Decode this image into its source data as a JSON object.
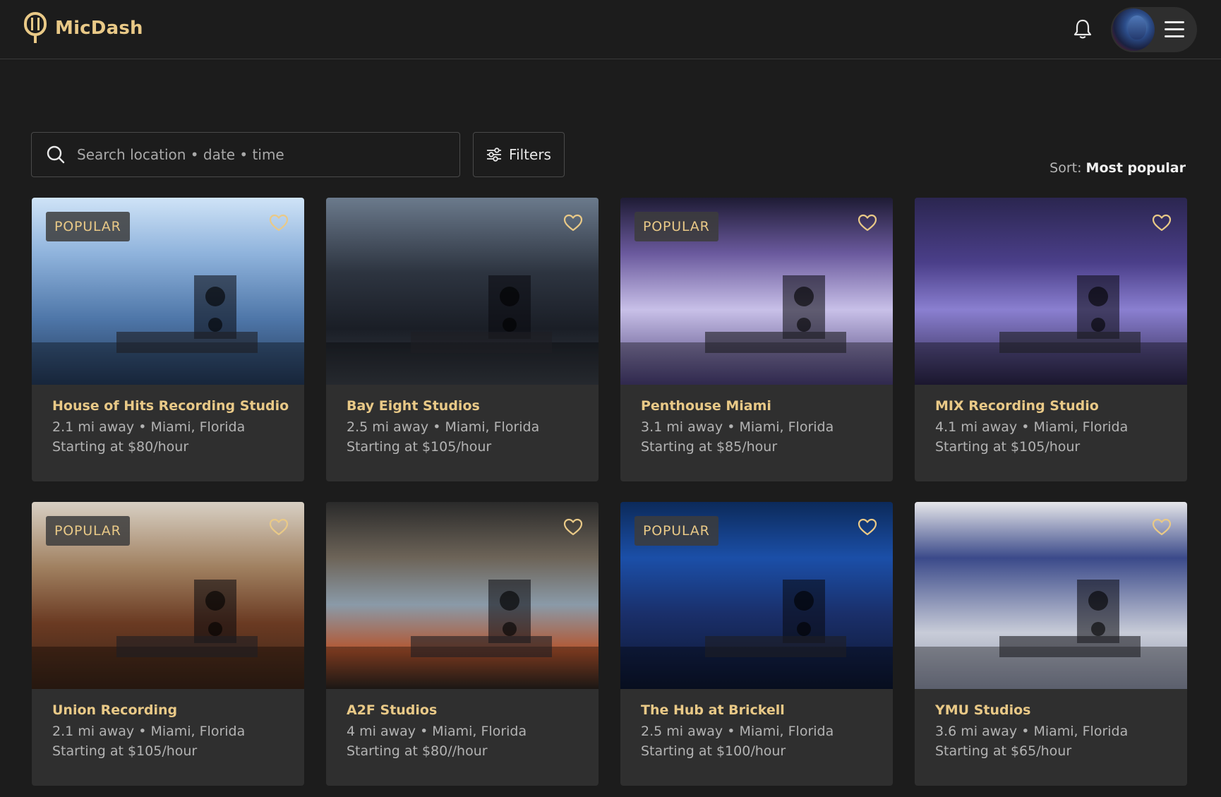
{
  "app": {
    "name": "MicDash"
  },
  "header": {
    "notifications_icon": "bell-icon",
    "menu_icon": "hamburger-icon"
  },
  "search": {
    "placeholder": "Search location • date • time",
    "filters_label": "Filters"
  },
  "sort": {
    "label": "Sort:",
    "value": "Most popular"
  },
  "studios": [
    {
      "name": "House of Hits Recording Studio",
      "distance": "2.1 mi away • Miami, Florida",
      "price": "Starting at $80/hour",
      "badge": "POPULAR"
    },
    {
      "name": "Bay Eight Studios",
      "distance": "2.5 mi away • Miami, Florida",
      "price": "Starting at $105/hour",
      "badge": ""
    },
    {
      "name": "Penthouse Miami",
      "distance": "3.1 mi away • Miami, Florida",
      "price": "Starting at $85/hour",
      "badge": "POPULAR"
    },
    {
      "name": "MIX Recording Studio",
      "distance": "4.1 mi away • Miami, Florida",
      "price": "Starting at $105/hour",
      "badge": ""
    },
    {
      "name": "Union Recording",
      "distance": "2.1 mi away • Miami, Florida",
      "price": "Starting at $105/hour",
      "badge": "POPULAR"
    },
    {
      "name": "A2F Studios",
      "distance": "4 mi away • Miami, Florida",
      "price": "Starting at $80//hour",
      "badge": ""
    },
    {
      "name": "The Hub at Brickell",
      "distance": "2.5 mi away • Miami, Florida",
      "price": "Starting at $100/hour",
      "badge": "POPULAR"
    },
    {
      "name": "YMU Studios",
      "distance": "3.6 mi away • Miami, Florida",
      "price": "Starting at $65/hour",
      "badge": ""
    }
  ],
  "colors": {
    "accent": "#e9c987",
    "background": "#1c1c1c",
    "card": "#2f2f2f"
  }
}
